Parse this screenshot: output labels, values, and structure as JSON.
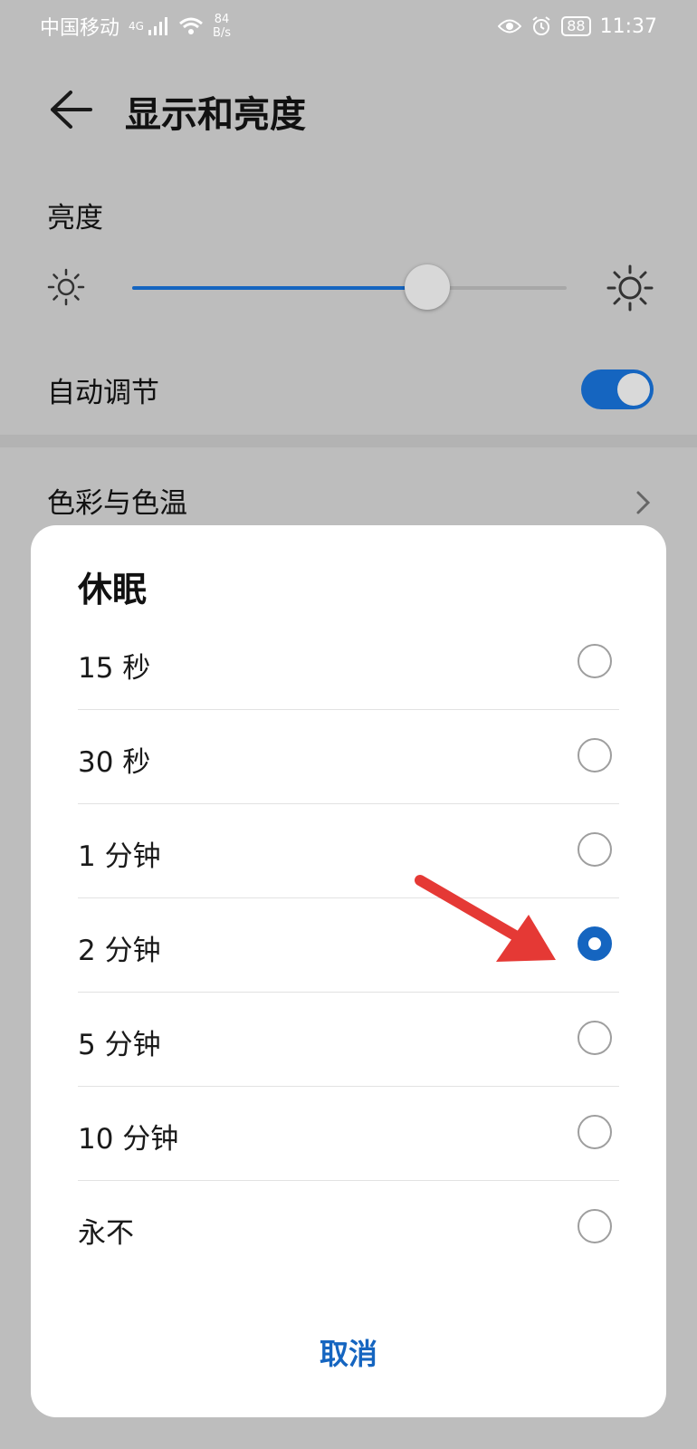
{
  "status_bar": {
    "carrier": "中国移动",
    "network": "4G",
    "speed_value": "84",
    "speed_unit": "B/s",
    "battery": "88",
    "time": "11:37"
  },
  "header": {
    "title": "显示和亮度"
  },
  "brightness": {
    "label": "亮度",
    "level": 0.68
  },
  "auto_adjust": {
    "label": "自动调节",
    "on": true
  },
  "color_temperature": {
    "label": "色彩与色温"
  },
  "dialog": {
    "title": "休眠",
    "options": [
      {
        "label": "15 秒",
        "selected": false
      },
      {
        "label": "30 秒",
        "selected": false
      },
      {
        "label": "1 分钟",
        "selected": false
      },
      {
        "label": "2 分钟",
        "selected": true
      },
      {
        "label": "5 分钟",
        "selected": false
      },
      {
        "label": "10 分钟",
        "selected": false
      },
      {
        "label": "永不",
        "selected": false
      }
    ],
    "cancel_label": "取消"
  },
  "colors": {
    "accent": "#1565c0",
    "annotation_arrow": "#e53935"
  }
}
